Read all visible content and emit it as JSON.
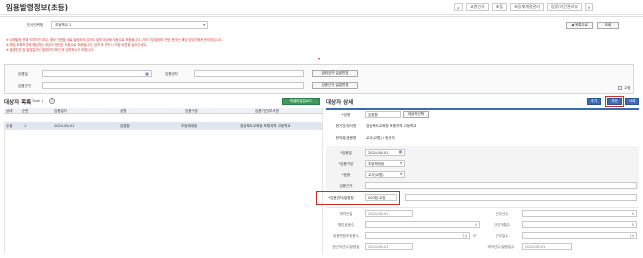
{
  "page": {
    "title": "임용발령정보(초등)"
  },
  "topnav": {
    "items": [
      "교원인사",
      "초등",
      "초등체계정관리",
      "임용/기간관리부"
    ]
  },
  "header": {
    "org_label": "인사인력청",
    "org_value": "초등학교 1",
    "btn_back": "◀ 목록으로",
    "btn_search": "조회"
  },
  "notices": [
    "※ 대체발령 관례 이루어진 경우, 해당 인원을 새로 발령하지 않아도 발령 대상에 자동으로 포함됩니다. 기타 기존발령자 관련 문의는 해당 담당자에게 문의하십시오.",
    "※ 해당 조회조건에 해당하는 대상자 명단은 자동으로 조회됩니다. 입력 후 반드시 저장 버튼을 눌러주세요.",
    "※ 발령번호 및 발령일자는 발령권자 확인 후 입력하시기 바랍니다."
  ],
  "filters": {
    "row1": {
      "date_label": "임용일",
      "org_label": "임용권자",
      "btn1": "발령권자 일괄변경"
    },
    "row2": {
      "label": "임용근거",
      "btn2": "임용근거 일괄변경",
      "checkbox": "고정"
    }
  },
  "left": {
    "title": "대상자 목록",
    "count": "Total 1",
    "excel_btn": "엑셀파일업로드",
    "columns": [
      "상태",
      "순번",
      "임용일자",
      "성명",
      "임용구분",
      "임용기관/부서명"
    ],
    "rows": [
      [
        "수정",
        "1",
        "2024-06-01",
        "김정환",
        "초등체계정",
        "경상북도교육청 포항지역 고등학교"
      ]
    ]
  },
  "right": {
    "title": "대상자 상세",
    "btn_add": "추가",
    "btn_save": "저장",
    "btn_delete": "삭제",
    "name_label": "*성명",
    "name_value": "김정환",
    "name_btn": "대상자선택",
    "org_label": "현기관/부서명",
    "org_value": "경상북도교육청 포항지역 고등학교",
    "rank_label": "현직위/호봉명",
    "rank_value": "교사(교원) / 정규직",
    "date_label": "*임용일",
    "date_value": "2024-06-01",
    "type_label": "*임용구분",
    "type_value": "초등체계정",
    "pos_label": "*호봉",
    "pos_value": "교사(교원)",
    "basis_label": "임용근거",
    "basis_value": "",
    "appt_label": "*임용권자/발령청",
    "appt_value": "000청 교장",
    "d1_label": "재직인일",
    "d1_value": "2024-06-01",
    "d1r_label": "근무년수",
    "d1r_value": "0",
    "d2_label": "원본호봉수",
    "d2_value": "0",
    "d2r_label": "근무개월수",
    "d2r_value": "0",
    "d3_label": "호봉변환후호봉수",
    "d3_value": "14",
    "d3m": "모",
    "d3r_label": "근무일수",
    "d3r_value": "14",
    "d4_label": "현근무년수/발령일",
    "d4_value": "2024-06-01",
    "d4r_label": "재직년수/발령일수",
    "d4r_value": "2024-06-01"
  }
}
